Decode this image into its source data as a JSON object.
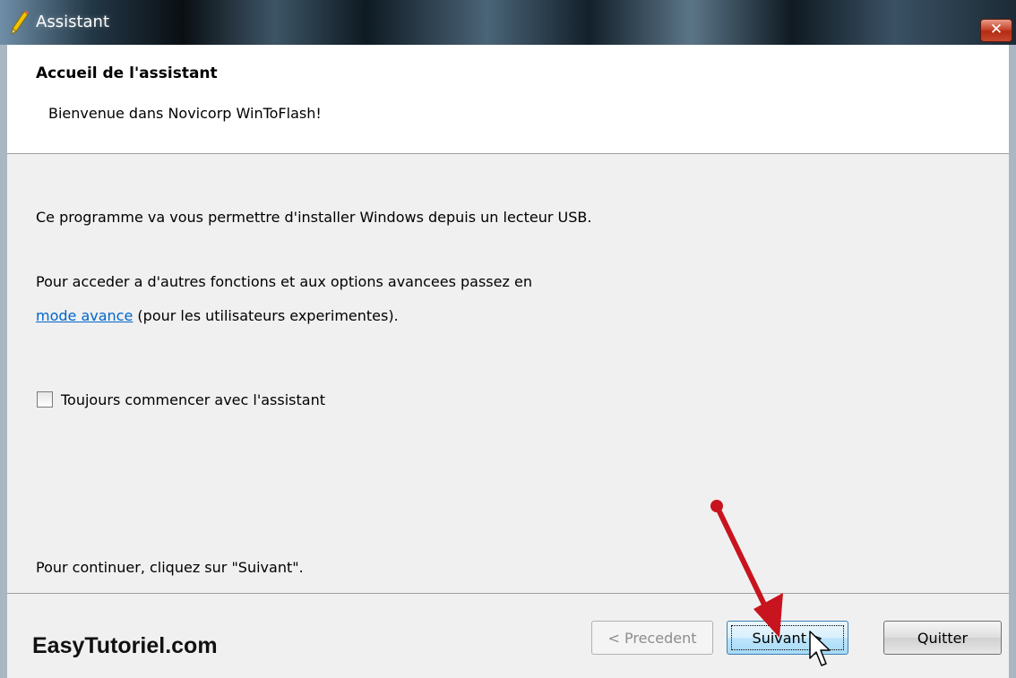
{
  "window": {
    "title": "Assistant",
    "close_symbol": "✕"
  },
  "header": {
    "title": "Accueil de l'assistant",
    "subtitle": "Bienvenue dans Novicorp WinToFlash!"
  },
  "content": {
    "line1": "Ce programme va vous permettre d'installer Windows depuis un lecteur USB.",
    "line2": "Pour acceder a d'autres fonctions et aux options avancees passez en",
    "link_text": "mode avance",
    "line3_rest": " (pour les utilisateurs experimentes).",
    "checkbox_label": "Toujours commencer avec l'assistant",
    "checkbox_checked": false,
    "continue_text": "Pour continuer, cliquez sur \"Suivant\"."
  },
  "footer": {
    "brand": "EasyTutoriel.com",
    "prev_label": "< Precedent",
    "next_label": "Suivant >",
    "quit_label": "Quitter"
  },
  "icons": {
    "app_icon": "pencil-icon",
    "close": "close-icon",
    "annotation": "red-arrow-icon",
    "cursor": "mouse-pointer-icon"
  },
  "colors": {
    "link": "#0066cc",
    "annotation_arrow": "#c8141e",
    "close_button": "#c7452b"
  }
}
